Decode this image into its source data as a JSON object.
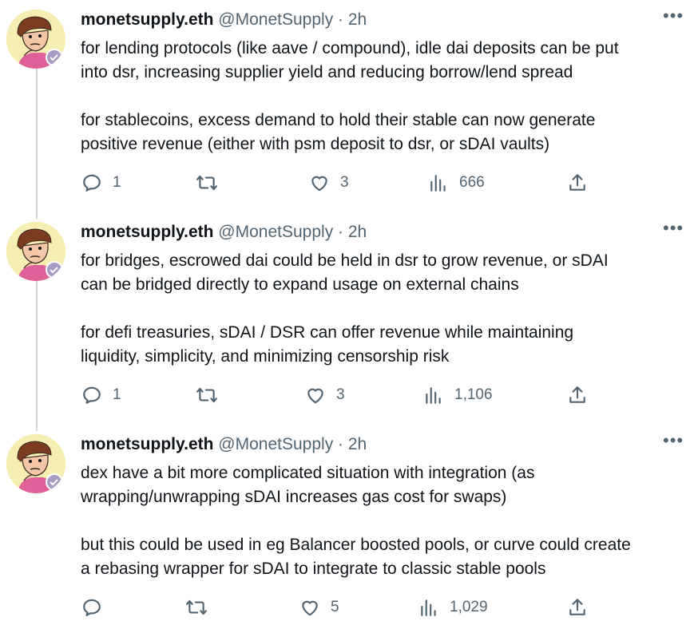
{
  "tweets": [
    {
      "name": "monetsupply.eth",
      "handle": "@MonetSupply",
      "time": "· 2h",
      "paragraphs": [
        "for lending protocols (like aave / compound), idle dai deposits can be put",
        "into dsr, increasing supplier yield and reducing borrow/lend spread",
        "",
        "for stablecoins, excess demand to hold their stable can now generate",
        "positive revenue (either with psm deposit to dsr, or sDAI vaults)"
      ],
      "replies": "1",
      "retweets": "",
      "likes": "3",
      "views": "666"
    },
    {
      "name": "monetsupply.eth",
      "handle": "@MonetSupply",
      "time": "· 2h",
      "paragraphs": [
        "for bridges, escrowed dai could be held in dsr to grow revenue, or sDAI",
        "can be bridged directly to expand usage on external chains",
        "",
        "for defi treasuries, sDAI / DSR can offer revenue while maintaining",
        "liquidity, simplicity, and minimizing censorship risk"
      ],
      "replies": "1",
      "retweets": "",
      "likes": "3",
      "views": "1,106"
    },
    {
      "name": "monetsupply.eth",
      "handle": "@MonetSupply",
      "time": "· 2h",
      "paragraphs": [
        "dex have a bit more complicated situation with integration (as",
        "wrapping/unwrapping sDAI increases gas cost for swaps)",
        "",
        "but this could be used in eg Balancer boosted pools, or curve could create",
        "a rebasing wrapper for sDAI to integrate to classic stable pools"
      ],
      "replies": "",
      "retweets": "",
      "likes": "5",
      "views": "1,029"
    }
  ],
  "icons": {
    "more": "more-icon",
    "reply": "reply-icon",
    "retweet": "retweet-icon",
    "like": "like-icon",
    "views": "views-icon",
    "share": "share-icon"
  },
  "colors": {
    "text": "#0f1419",
    "secondary": "#536471",
    "thread_line": "#cfd9de",
    "avatar_bg": "#f6eeb2"
  }
}
